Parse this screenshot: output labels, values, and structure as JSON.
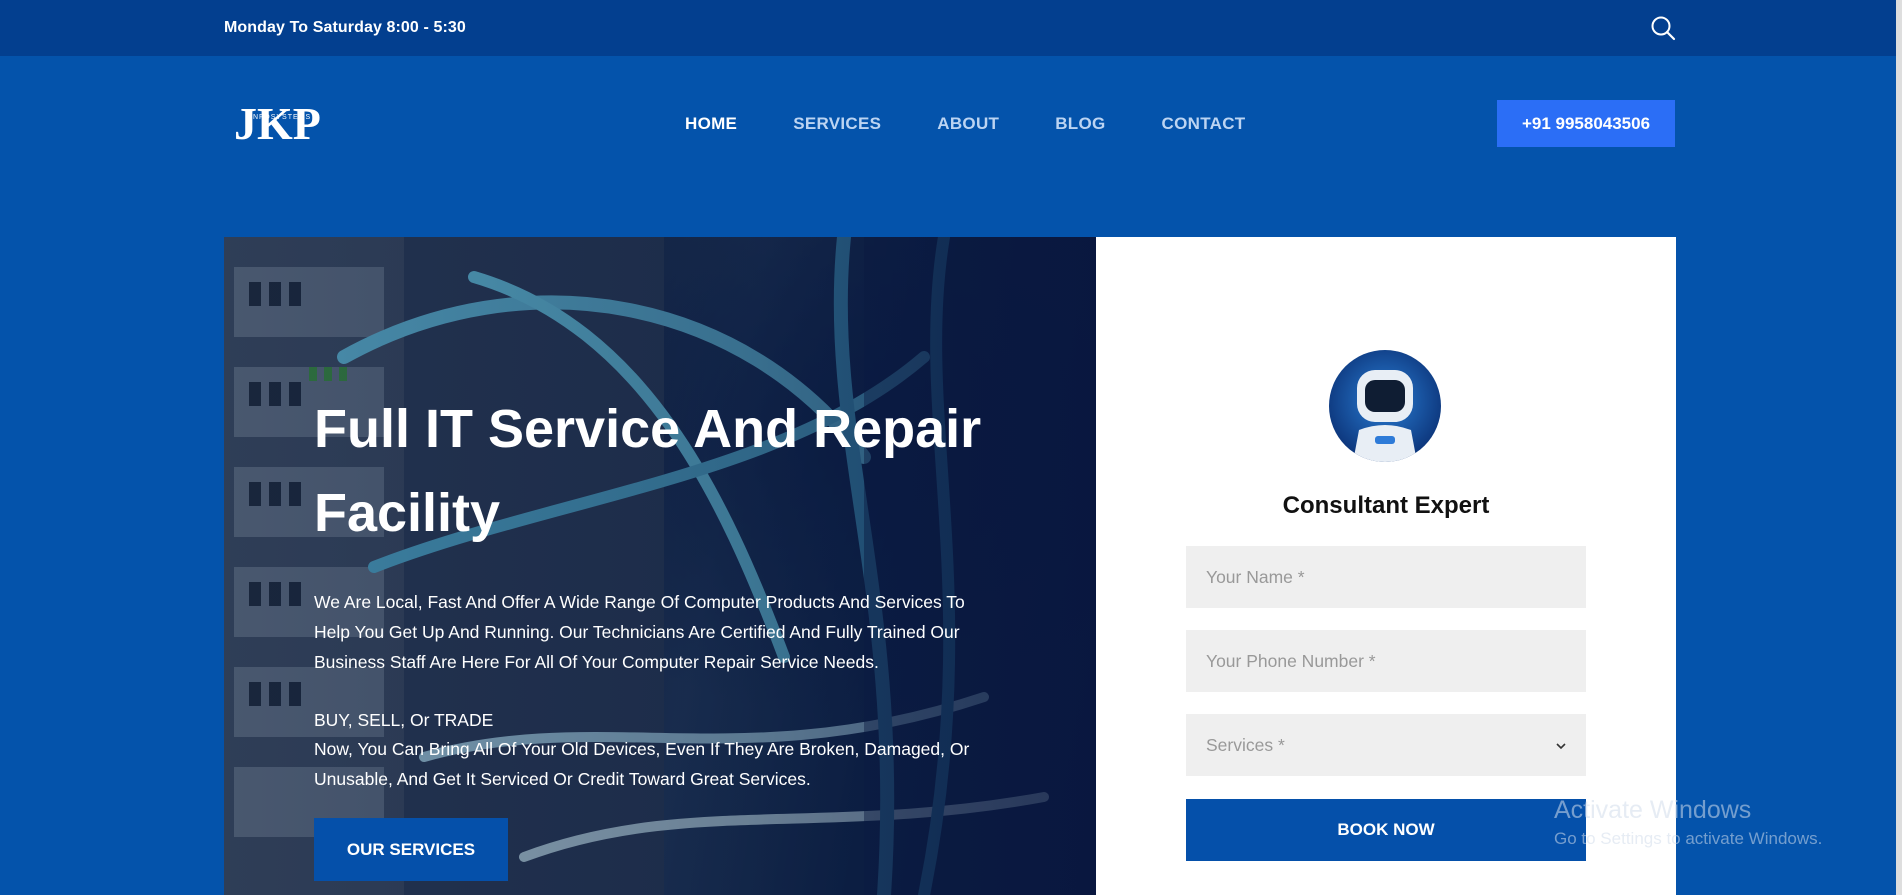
{
  "topbar": {
    "hours": "Monday To Saturday  8:00 - 5:30"
  },
  "header": {
    "logo_text": "JKP",
    "logo_subtext": "INFOSYSTEMS",
    "nav": [
      {
        "label": "HOME",
        "active": true
      },
      {
        "label": "SERVICES",
        "active": false
      },
      {
        "label": "ABOUT",
        "active": false
      },
      {
        "label": "BLOG",
        "active": false
      },
      {
        "label": "CONTACT",
        "active": false
      }
    ],
    "phone_label": "+91 9958043506"
  },
  "hero": {
    "title": "Full IT Service And Repair Facility",
    "description": "We Are Local, Fast And Offer A Wide Range Of Computer Products And Services To Help You Get Up And Running. Our Technicians Are Certified And Fully Trained Our Business Staff Are Here For All Of Your Computer Repair Service Needs.",
    "tagline": "BUY, SELL, Or TRADE",
    "description2": "Now, You Can Bring All Of Your Old Devices, Even If They Are Broken, Damaged, Or Unusable, And Get It Serviced Or Credit Toward Great Services.",
    "cta_label": "OUR SERVICES"
  },
  "form": {
    "title": "Consultant Expert",
    "name_placeholder": "Your Name *",
    "phone_placeholder": "Your Phone Number *",
    "services_label": "Services *",
    "submit_label": "BOOK NOW"
  },
  "watermark": {
    "title": "Activate Windows",
    "subtitle": "Go to Settings to activate Windows."
  },
  "colors": {
    "page_bg": "#0453ab",
    "topbar_bg": "#033f8f",
    "accent": "#2b6ef6",
    "button_bg": "#0550aa"
  }
}
